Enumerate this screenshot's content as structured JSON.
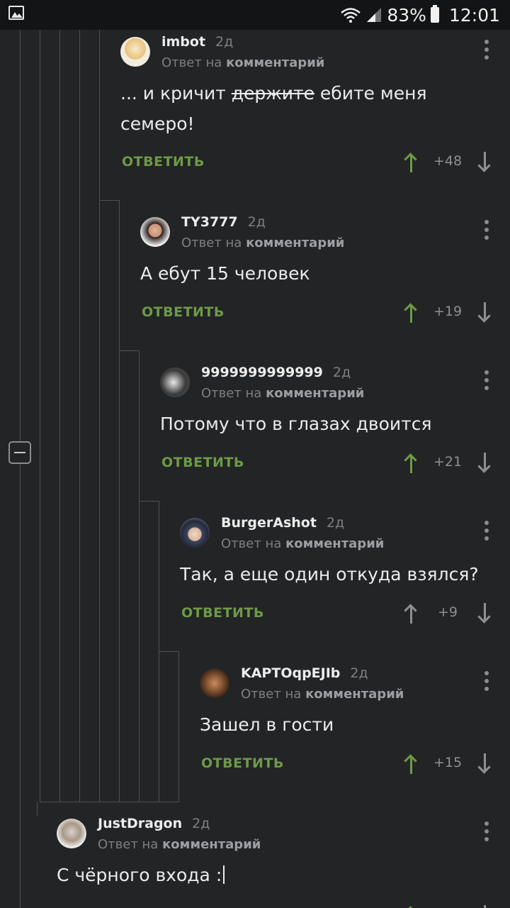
{
  "status_bar": {
    "battery": "83%",
    "time": "12:01"
  },
  "reply_label": "Ответ на",
  "reply_target": "комментарий",
  "answer_label": "ОТВЕТИТЬ",
  "colors": {
    "background": "#222426",
    "accent_green": "#6e9a46",
    "muted": "#7d8084"
  },
  "comments": [
    {
      "author": "imbot",
      "time": "2д",
      "text_before": "... и кричит ",
      "text_struck": "держите",
      "text_after": " ебите меня семеро!",
      "score": "+48",
      "upvoted": true
    },
    {
      "author": "TY3777",
      "time": "2д",
      "text": "А ебут 15 человек",
      "score": "+19",
      "upvoted": true
    },
    {
      "author": "9999999999999",
      "time": "2д",
      "text": "Потому что в глазах двоится",
      "score": "+21",
      "upvoted": true
    },
    {
      "author": "BurgerAshot",
      "time": "2д",
      "text": "Так, а еще один откуда взялся?",
      "score": "+9",
      "upvoted": false
    },
    {
      "author": "KAPTOqpEJIb",
      "time": "2д",
      "text": "Зашел в гости",
      "score": "+15",
      "upvoted": true
    },
    {
      "author": "JustDragon",
      "time": "2д",
      "text": "С чёрного входа :",
      "score": "",
      "upvoted": true
    }
  ]
}
